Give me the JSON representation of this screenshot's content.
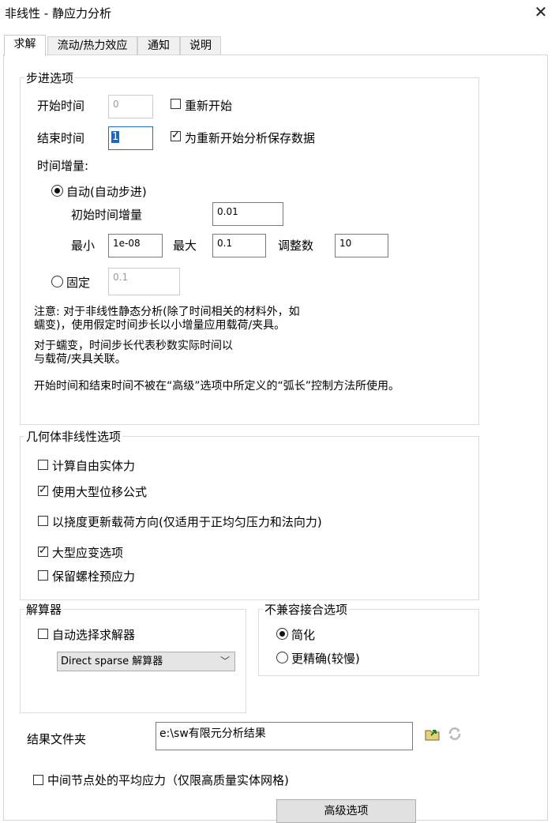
{
  "window": {
    "title": "非线性 - 静应力分析",
    "close_glyph": "✕"
  },
  "tabs": [
    {
      "label": "求解",
      "active": true
    },
    {
      "label": "流动/热力效应"
    },
    {
      "label": "通知"
    },
    {
      "label": "说明"
    }
  ],
  "stepping": {
    "legend": "步进选项",
    "start_time_label": "开始时间",
    "start_time_value": "0",
    "restart_label": "重新开始",
    "restart_checked": false,
    "end_time_label": "结束时间",
    "end_time_value": "1",
    "save_restart_label": "为重新开始分析保存数据",
    "save_restart_checked": true,
    "increment_label": "时间增量:",
    "auto_label": "自动(自动步进)",
    "auto_selected": true,
    "initial_increment_label": "初始时间增量",
    "initial_increment_value": "0.01",
    "min_label": "最小",
    "min_value": "1e-08",
    "max_label": "最大",
    "max_value": "0.1",
    "adjust_label": "调整数",
    "adjust_value": "10",
    "fixed_label": "固定",
    "fixed_selected": false,
    "fixed_value": "0.1",
    "note1_line1": "注意: 对于非线性静态分析(除了时间相关的材料外，如",
    "note1_line2": "蠕变)，使用假定时间步长以小增量应用载荷/夹具。",
    "note2_line1": "对于蠕变，时间步长代表秒数实际时间以",
    "note2_line2": "与载荷/夹具关联。",
    "note3": "开始时间和结束时间不被在“高级”选项中所定义的“弧长”控制方法所使用。"
  },
  "geometry": {
    "legend": "几何体非线性选项",
    "options": [
      {
        "label": "计算自由实体力",
        "checked": false
      },
      {
        "label": "使用大型位移公式",
        "checked": true
      },
      {
        "label": "以挠度更新载荷方向(仅适用于正均匀压力和法向力)",
        "checked": false
      },
      {
        "label": "大型应变选项",
        "checked": true
      },
      {
        "label": "保留螺栓预应力",
        "checked": false
      }
    ]
  },
  "solver": {
    "legend": "解算器",
    "auto_select_label": "自动选择求解器",
    "auto_select_checked": false,
    "selected": "Direct sparse 解算器"
  },
  "contact": {
    "legend": "不兼容接合选项",
    "simplified_label": "简化",
    "simplified_selected": true,
    "accurate_label": "更精确(较慢)",
    "accurate_selected": false
  },
  "results": {
    "label": "结果文件夹",
    "value": "e:\\sw有限元分析结果"
  },
  "average_stress": {
    "label": "中间节点处的平均应力（仅限高质量实体网格)",
    "checked": false
  },
  "button": {
    "label": "高级选项"
  }
}
